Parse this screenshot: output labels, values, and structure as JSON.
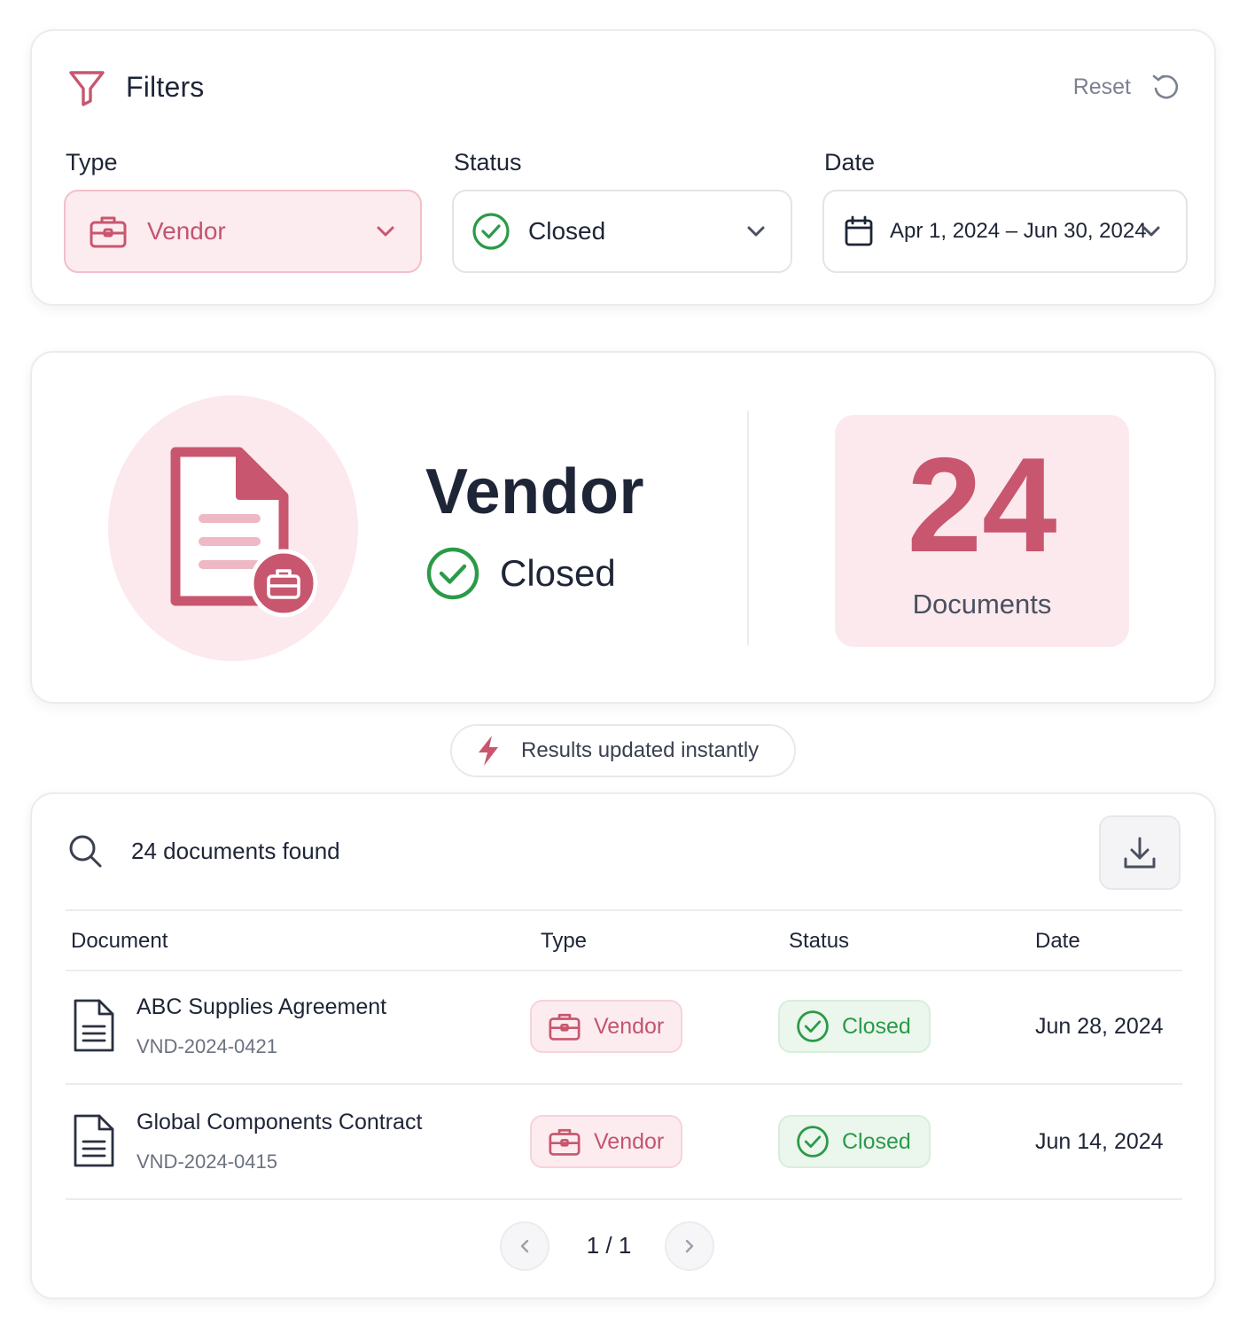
{
  "colors": {
    "accent": "#c8566f",
    "accent_soft": "#fbe9ed",
    "success": "#2b9a48",
    "success_soft": "#ebf6ed",
    "text_primary": "#1e2536",
    "text_muted": "#7b8190"
  },
  "filters": {
    "title": "Filters",
    "title_icon": "funnel-icon",
    "reset_label": "Reset",
    "reset_icon": "reset-icon",
    "type": {
      "label": "Type",
      "value": "Vendor",
      "icon": "briefcase-icon"
    },
    "status": {
      "label": "Status",
      "value": "Closed",
      "icon": "check-circle-icon"
    },
    "date": {
      "label": "Date",
      "value": "Apr 1, 2024 – Jun 30, 2024",
      "icon": "calendar-icon"
    }
  },
  "summary": {
    "title": "Vendor",
    "status": "Closed",
    "count": "24",
    "count_label": "Documents",
    "icon": "document-briefcase-icon"
  },
  "notice": {
    "text": "Results updated instantly",
    "icon": "lightning-icon"
  },
  "results": {
    "count_text": "24 documents found",
    "columns": [
      "Document",
      "Type",
      "Status",
      "Date"
    ],
    "rows": [
      {
        "name": "ABC Supplies Agreement",
        "id": "VND-2024-0421",
        "type": "Vendor",
        "status": "Closed",
        "date": "Jun 28, 2024"
      },
      {
        "name": "Global Components Contract",
        "id": "VND-2024-0415",
        "type": "Vendor",
        "status": "Closed",
        "date": "Jun 14, 2024"
      }
    ],
    "pagination": "1 / 1"
  }
}
